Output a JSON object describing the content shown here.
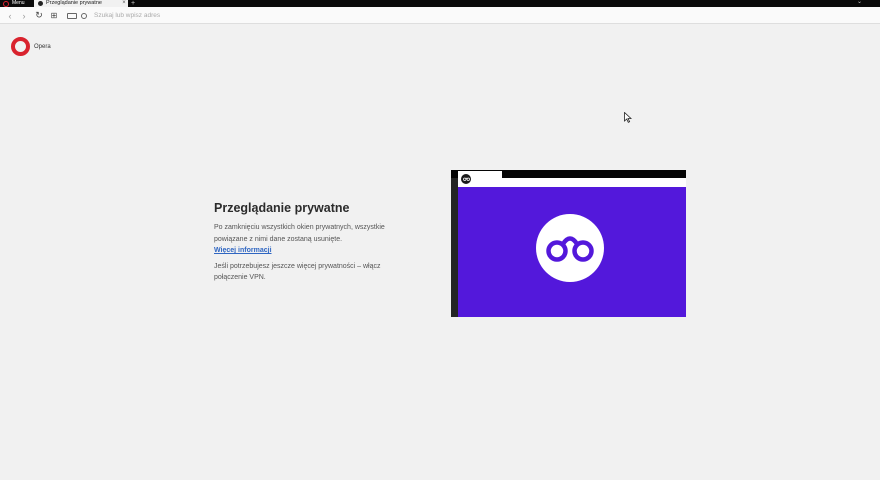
{
  "browser": {
    "menu_label": "Menu",
    "tab": {
      "title": "Przeglądanie prywatne",
      "close": "×"
    },
    "new_tab": "+",
    "tabbar_chevron": "⌄"
  },
  "toolbar": {
    "back": "‹",
    "forward": "›",
    "reload": "↻",
    "grid": "⊞",
    "address_placeholder": "Szukaj lub wpisz adres"
  },
  "brand": {
    "name": "Opera"
  },
  "private": {
    "title": "Przeglądanie prywatne",
    "description": "Po zamknięciu wszystkich okien prywatnych, wszystkie powiązane z nimi dane zostaną usunięte.",
    "more_link": "Więcej informacji",
    "vpn_text": "Jeśli potrzebujesz jeszcze więcej prywatności – włącz połączenie VPN."
  },
  "colors": {
    "opera_red": "#d9232e",
    "private_purple": "#5318db",
    "link_blue": "#2f66c2"
  },
  "icons": [
    "opera-logo-icon",
    "close-icon",
    "back-icon",
    "forward-icon",
    "reload-icon",
    "speed-dial-icon",
    "keyboard-icon",
    "search-icon",
    "private-glasses-icon",
    "cursor-icon"
  ]
}
